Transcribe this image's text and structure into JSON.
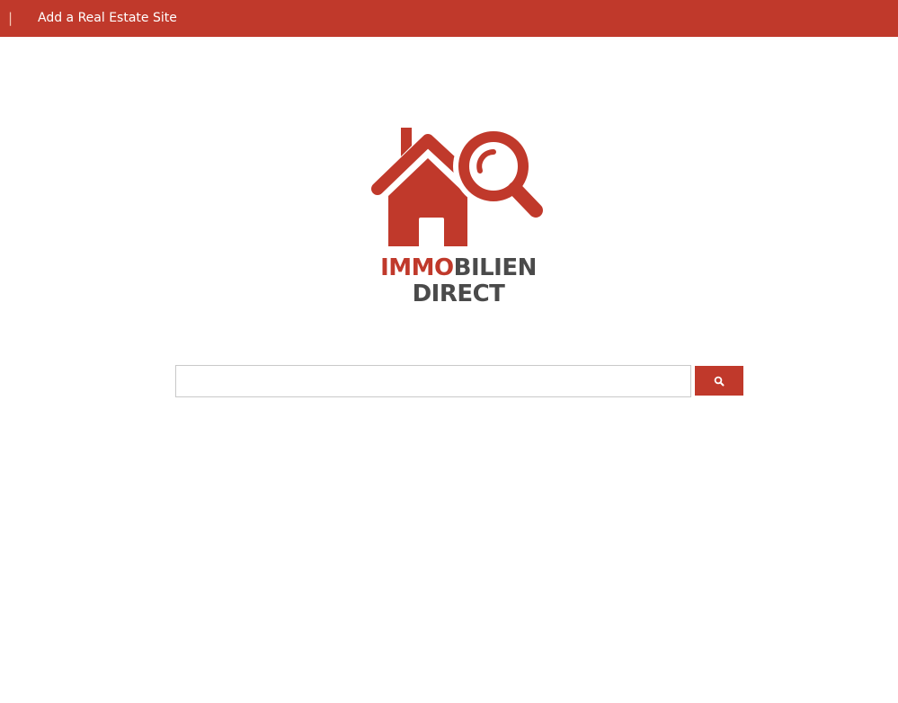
{
  "topbar": {
    "separator": "|",
    "add_site_label": "Add a Real Estate Site"
  },
  "logo": {
    "word_red": "IMMO",
    "word_gray": "BILIEN",
    "line2": "DIRECT"
  },
  "search": {
    "value": "",
    "placeholder": "",
    "button_icon": "search-icon"
  },
  "colors": {
    "brand_red": "#c0392b",
    "text_gray": "#4a4a4a",
    "background": "#ffffff"
  }
}
